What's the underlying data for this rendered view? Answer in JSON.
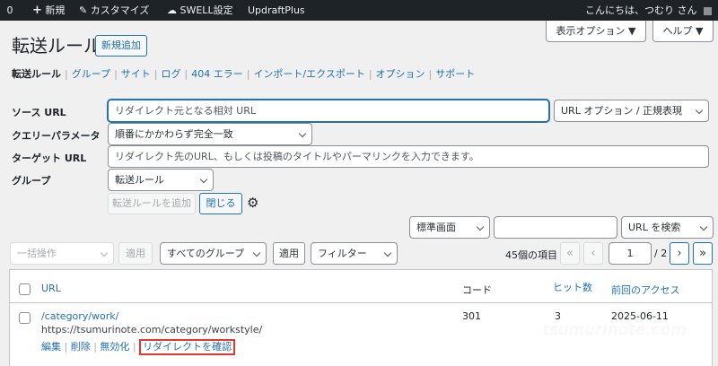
{
  "admin_bar": {
    "comment_count": "0",
    "new_label": "新規",
    "customize_label": "カスタマイズ",
    "swell_label": "SWELL設定",
    "updraft_label": "UpdraftPlus",
    "greeting": "こんにちは、つむり さん"
  },
  "screen_meta": {
    "options_label": "表示オプション ▼",
    "help_label": "ヘルプ ▼"
  },
  "page": {
    "title": "転送ルール",
    "add_new_label": "新規追加"
  },
  "subnav": {
    "items": [
      "転送ルール",
      "グループ",
      "サイト",
      "ログ",
      "404 エラー",
      "インポート/エクスポート",
      "オプション",
      "サポート"
    ]
  },
  "form": {
    "source_label": "ソース URL",
    "source_placeholder": "リダイレクト元となる相対 URL",
    "url_options": "URL オプション / 正規表現",
    "query_label": "クエリーパラメータ",
    "query_value": "順番にかかわらず完全一致",
    "target_label": "ターゲット URL",
    "target_placeholder": "リダイレクト先のURL、もしくは投稿のタイトルやパーマリンクを入力できます。",
    "group_label": "グループ",
    "group_value": "転送ルール",
    "add_button": "転送ルールを追加",
    "close_button": "閉じる"
  },
  "search": {
    "view_mode": "標準画面",
    "search_value": "",
    "search_by": "URL を検索"
  },
  "tablenav": {
    "bulk_actions": "一括操作",
    "apply_label": "適用",
    "all_groups": "すべてのグループ",
    "apply2_label": "適用",
    "filter_label": "フィルター",
    "item_count": "45個の項目",
    "first": "«",
    "prev": "‹",
    "current_page": "1",
    "total_pages": "/ 2",
    "next": "›",
    "last": "»"
  },
  "table": {
    "columns": [
      "URL",
      "コード",
      "ヒット数",
      "前回のアクセス"
    ],
    "rows": [
      {
        "url": "/category/work/",
        "target": "https://tsumurinote.com/category/workstyle/",
        "code": "301",
        "hits": "3",
        "last_access": "2025-06-11",
        "actions": [
          "編集",
          "削除",
          "無効化",
          "リダイレクトを確認"
        ]
      }
    ]
  },
  "watermark": "tsumurinote.com",
  "colors": {
    "accent": "#2271b1",
    "admin_bar": "#1d2327",
    "highlight_box": "#e0392c"
  }
}
